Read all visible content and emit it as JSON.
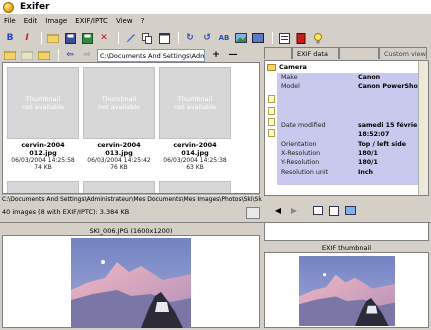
{
  "window": {
    "title": "Exifer"
  },
  "menu": [
    "File",
    "Edit",
    "Image",
    "EXIF/IPTC",
    "View",
    "?"
  ],
  "toolbar": {
    "path_value": "C:\\Documents And Settings\\Admin"
  },
  "tabs": [
    {
      "label": "",
      "active": false
    },
    {
      "label": "EXIF data",
      "active": true
    },
    {
      "label": "",
      "active": false
    },
    {
      "label": "Custom view",
      "active": false
    }
  ],
  "thumbnails": [
    {
      "placeholder": "Thumbnail\nnot available",
      "name": "cervin-2004 012.jpg",
      "date": "06/03/2004 14:25:58",
      "size": "74 KB"
    },
    {
      "placeholder": "Thumbnail\nnot available",
      "name": "cervin-2004 013.jpg",
      "date": "06/03/2004 14:25:42",
      "size": "76 KB"
    },
    {
      "placeholder": "Thumbnail\nnot available",
      "name": "cervin-2004 014.jpg",
      "date": "06/03/2004 14:25:38",
      "size": "63 KB"
    }
  ],
  "exif": {
    "section": "Camera",
    "rows": [
      {
        "key": "Make",
        "value": "Canon"
      },
      {
        "key": "Model",
        "value": "Canon PowerSho"
      },
      {
        "key": "",
        "value": ""
      },
      {
        "key": "",
        "value": ""
      },
      {
        "key": "Date modified",
        "value": "samedi 15 févrie"
      },
      {
        "key": "",
        "value": "18:52:07"
      },
      {
        "key": "Orientation",
        "value": "Top / left side"
      },
      {
        "key": "X-Resolution",
        "value": "180/1"
      },
      {
        "key": "Y-Resolution",
        "value": "180/1"
      },
      {
        "key": "Resolution unit",
        "value": "Inch"
      }
    ]
  },
  "status": {
    "path": "C:\\Documents And Settings\\Administrateur\\Mes Documents\\Mes Images\\Photos\\Ski\\Sk",
    "count": "40 images (8 with EXIF/IPTC): 3.384 KB"
  },
  "preview": {
    "caption": "SKI_006.JPG (1600x1200)",
    "exif_thumb_caption": "EXIF thumbnail"
  },
  "colors": {
    "exif_bg": "#c8c9ec",
    "sky": "#7f8fc6",
    "mountain": "#e6a9b8"
  }
}
